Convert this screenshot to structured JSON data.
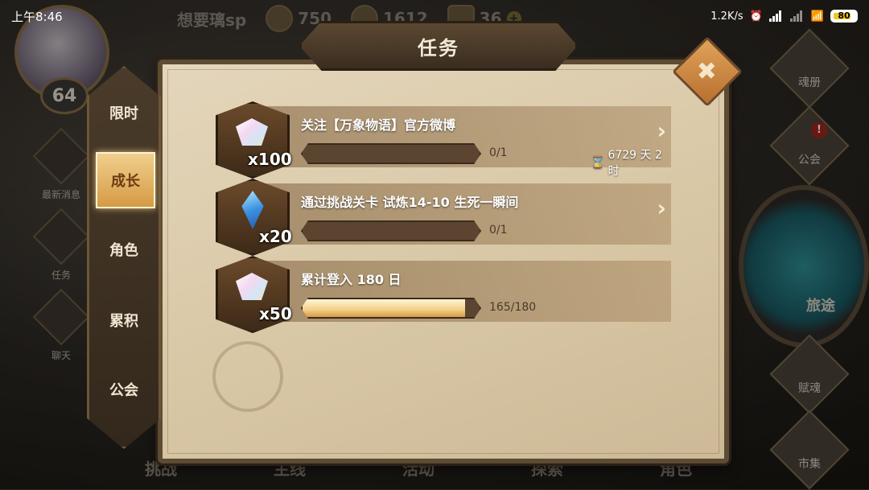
{
  "status_bar": {
    "time": "上午8:46",
    "network_speed": "1.2K/s",
    "battery": "80",
    "battery_percent": 80
  },
  "topbar": {
    "player_name": "想要璃sp",
    "gold": "750",
    "gems": "1612",
    "tickets": "36"
  },
  "player": {
    "level": "64"
  },
  "left_menu": {
    "items": [
      {
        "label": "最新消息",
        "icon": "cat-icon"
      },
      {
        "label": "任务",
        "icon": "shield-icon"
      },
      {
        "label": "聊天",
        "icon": "chat-icon"
      }
    ]
  },
  "right_menu": {
    "soul_book": "魂册",
    "guild": "公会",
    "travel": "旅途",
    "endow_soul": "赋魂",
    "market": "市集",
    "alert": "!"
  },
  "bottom_menu": {
    "items": [
      "挑战",
      "主线",
      "活动",
      "探索",
      "角色"
    ]
  },
  "dialog": {
    "title": "任务",
    "close": "✖",
    "tabs": [
      {
        "label": "限时",
        "active": false
      },
      {
        "label": "成长",
        "active": true
      },
      {
        "label": "角色",
        "active": false
      },
      {
        "label": "累积",
        "active": false
      },
      {
        "label": "公会",
        "active": false
      }
    ],
    "quests": [
      {
        "title": "关注【万象物语】官方微博",
        "reward_icon": "crystal-gem-icon",
        "reward_count": "x100",
        "progress_text": "0/1",
        "progress": 0,
        "timer": "6729 天 2 时",
        "has_arrow": true
      },
      {
        "title": "通过挑战关卡 试炼14-10 生死一瞬间",
        "reward_icon": "blue-crystal-icon",
        "reward_count": "x20",
        "progress_text": "0/1",
        "progress": 0,
        "timer": "",
        "has_arrow": true
      },
      {
        "title": "累计登入 180 日",
        "reward_icon": "crystal-gem-icon",
        "reward_count": "x50",
        "progress_text": "165/180",
        "progress": 0.9167,
        "timer": "",
        "has_arrow": false
      }
    ]
  }
}
